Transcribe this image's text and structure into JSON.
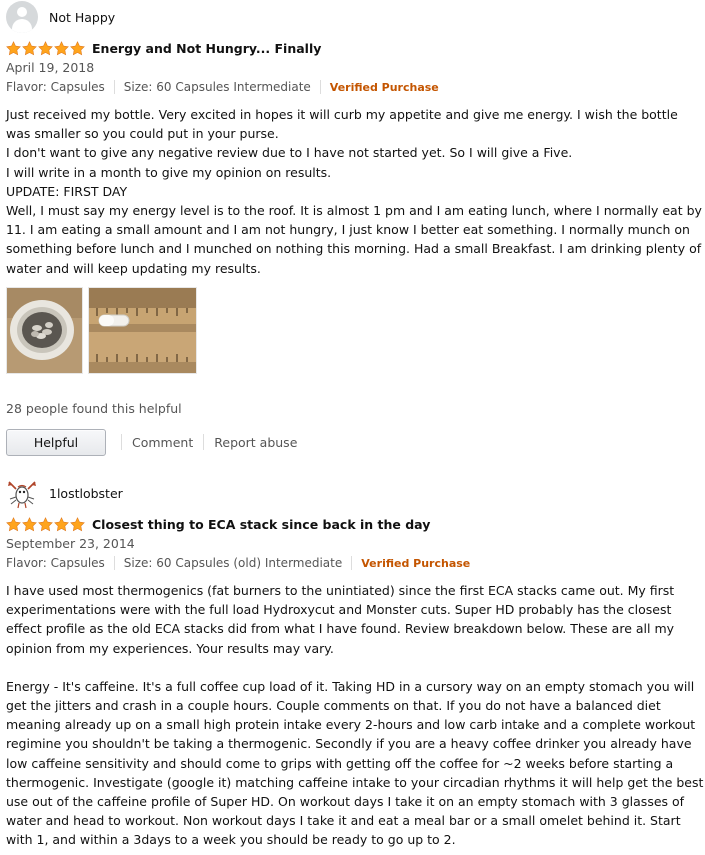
{
  "reviews": [
    {
      "profile_name": "Not Happy",
      "rating": 5,
      "title": "Energy and Not Hungry... Finally",
      "date": "April 19, 2018",
      "flavor": "Flavor: Capsules",
      "size": "Size: 60 Capsules Intermediate",
      "verified": "Verified Purchase",
      "body": [
        "Just received my bottle. Very excited in hopes it will curb my appetite and give me energy. I wish the bottle was smaller so you could put in your purse.",
        "I don't want to give any negative review due to I have not started yet. So I will give a Five.",
        "I will write in a month to give my opinion on results.",
        "UPDATE: FIRST DAY",
        "Well, I must say my energy level is to the roof. It is almost 1 pm and I am eating lunch, where I normally eat by 11. I am eating a small amount and I am not hungry, I just know I better eat something. I normally munch on something before lunch and I munched on nothing this morning. Had a small Breakfast. I am drinking plenty of water and will keep updating my results."
      ],
      "helpful_count": "28 people found this helpful",
      "helpful_label": "Helpful",
      "comment_label": "Comment",
      "report_label": "Report abuse"
    },
    {
      "profile_name": "1lostlobster",
      "rating": 5,
      "title": "Closest thing to ECA stack since back in the day",
      "date": "September 23, 2014",
      "flavor": "Flavor: Capsules",
      "size": "Size: 60 Capsules (old) Intermediate",
      "verified": "Verified Purchase",
      "body": [
        "I have used most thermogenics (fat burners to the unintiated) since the first ECA stacks came out. My first experimentations were with the full load Hydroxycut and Monster cuts. Super HD probably has the closest effect profile as the old ECA stacks did from what I have found. Review breakdown below. These are all my opinion from my experiences. Your results may vary.",
        "",
        "Energy - It's caffeine. It's a full coffee cup load of it. Taking HD in a cursory way on an empty stomach you will get the jitters and crash in a couple hours. Couple comments on that. If you do not have a balanced diet meaning already up on a small high protein intake every 2-hours and low carb intake and a complete workout regimine you shouldn't be taking a thermogenic. Secondly if you are a heavy coffee drinker you already have low caffeine sensitivity and should come to grips with getting off the coffee for ~2 weeks before starting a thermogenic. Investigate (google it) matching caffeine intake to your circadian rhythms it will help get the best use out of the caffeine profile of Super HD. On workout days I take it on an empty stomach with 3 glasses of water and head to workout. Non workout days I take it and eat a meal bar or a small omelet behind it. Start with 1, and within a 3days to a week you should be ready to go up to 2."
      ]
    }
  ],
  "colors": {
    "star": "#ffa41c",
    "verified": "#c45500",
    "muted": "#555555"
  },
  "icons": [
    "default-avatar-icon",
    "lobster-avatar-icon",
    "star-icon"
  ]
}
